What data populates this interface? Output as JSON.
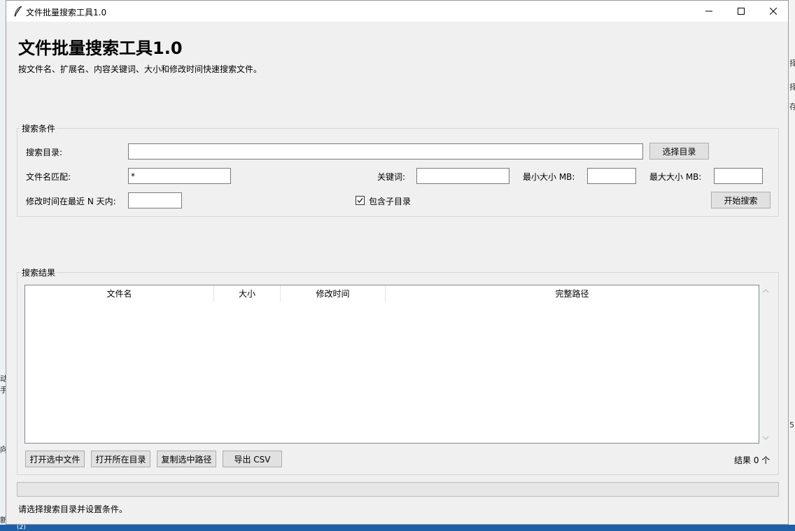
{
  "window": {
    "title": "文件批量搜索工具1.0"
  },
  "header": {
    "title": "文件批量搜索工具1.0",
    "subtitle": "按文件名、扩展名、内容关键词、大小和修改时间快速搜索文件。"
  },
  "criteria": {
    "group_label": "搜索条件",
    "dir_label": "搜索目录:",
    "dir_value": "",
    "choose_dir_button": "选择目录",
    "name_label": "文件名匹配:",
    "name_value": "*",
    "keyword_label": "关键词:",
    "keyword_value": "",
    "min_size_label": "最小大小 MB:",
    "min_size_value": "",
    "max_size_label": "最大大小 MB:",
    "max_size_value": "",
    "days_label": "修改时间在最近 N 天内:",
    "days_value": "",
    "subdir_label": "包含子目录",
    "subdir_checked": true,
    "search_button": "开始搜索"
  },
  "results": {
    "group_label": "搜索结果",
    "columns": [
      "文件名",
      "大小",
      "修改时间",
      "完整路径"
    ],
    "rows": [],
    "open_file_button": "打开选中文件",
    "open_dir_button": "打开所在目录",
    "copy_path_button": "复制选中路径",
    "export_button": "导出 CSV",
    "count_text": "结果 0 个"
  },
  "progress": 0,
  "status": "请选择搜索目录并设置条件。",
  "background": {
    "right_fragments": [
      "择",
      "择",
      "存",
      "5"
    ],
    "left_fragments": [
      "动",
      "手",
      "向",
      "新"
    ],
    "bottom_fragment": "(2)"
  }
}
